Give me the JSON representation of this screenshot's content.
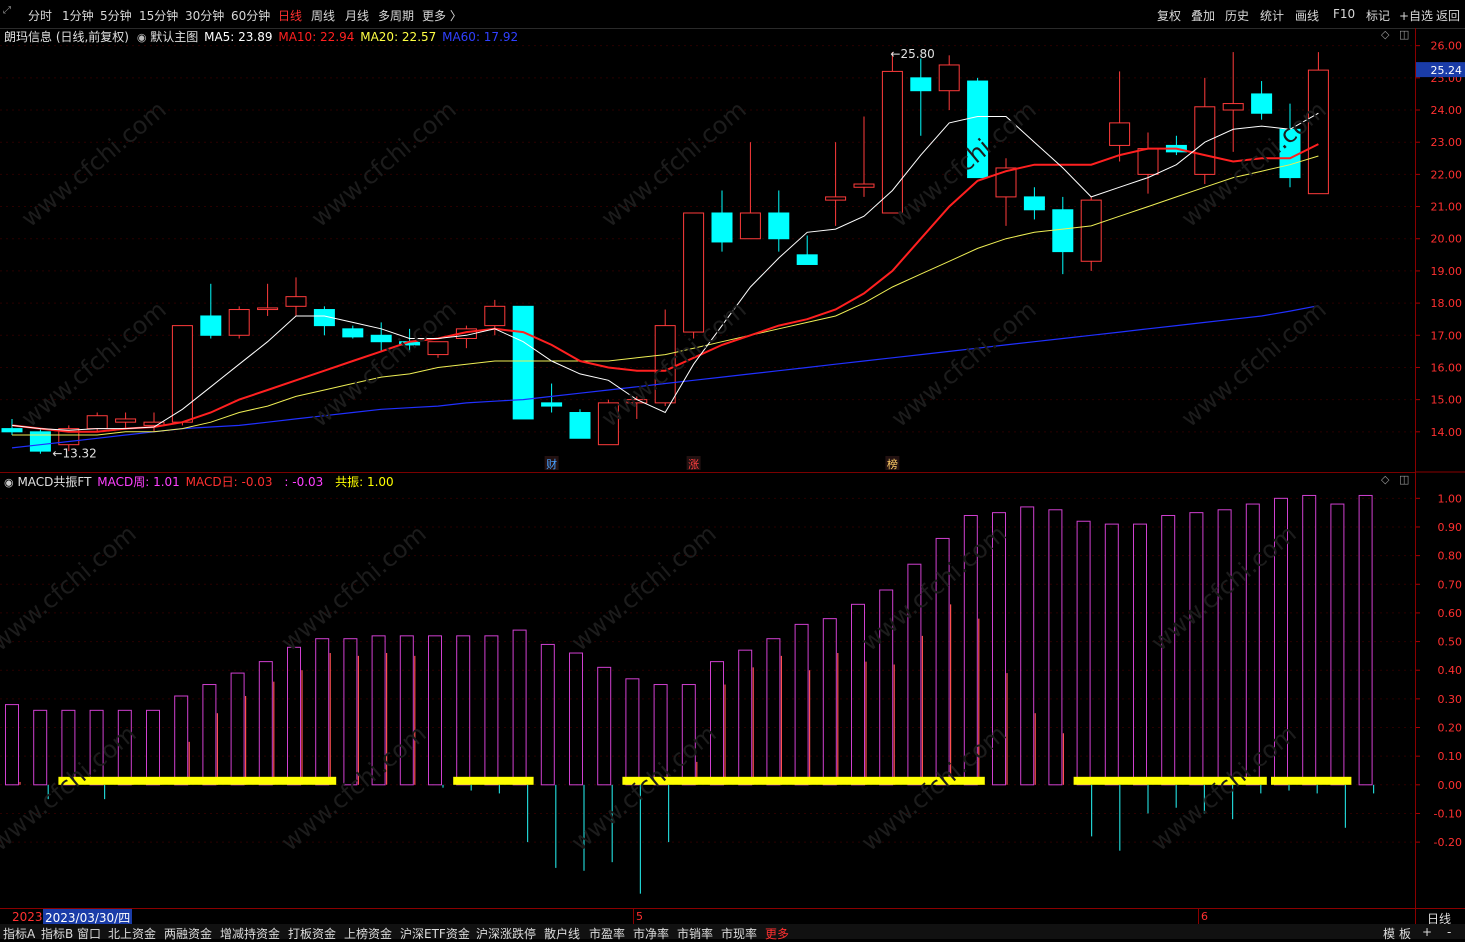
{
  "toolbar": {
    "timeframes": [
      "分时",
      "1分钟",
      "5分钟",
      "15分钟",
      "30分钟",
      "60分钟",
      "日线",
      "周线",
      "月线",
      "多周期",
      "更多 〉"
    ],
    "active_timeframe": "日线",
    "right_buttons": [
      "复权",
      "叠加",
      "历史",
      "统计",
      "画线",
      "F10",
      "标记",
      "+自选",
      "返回"
    ]
  },
  "main_chart": {
    "stock_title": "朗玛信息 (日线,前复权)",
    "template_label": "默认主图",
    "ma_legend": [
      {
        "label": "MA5: 23.89",
        "color": "#ffffff"
      },
      {
        "label": "MA10: 22.94",
        "color": "#ff2020"
      },
      {
        "label": "MA20: 22.57",
        "color": "#ffff44"
      },
      {
        "label": "MA60: 17.92",
        "color": "#3040ff"
      }
    ],
    "price_axis": [
      "26.00",
      "25.00",
      "24.00",
      "23.00",
      "22.00",
      "21.00",
      "20.00",
      "19.00",
      "18.00",
      "17.00",
      "16.00",
      "15.00",
      "14.00"
    ],
    "current_price": "25.24",
    "high_annotation": "25.80",
    "low_annotation": "13.32",
    "markers": [
      "财",
      "涨",
      "榜"
    ]
  },
  "macd_panel": {
    "title": "MACD共振FT",
    "legend": [
      {
        "label": "MACD周: 1.01",
        "color": "#ff40ff"
      },
      {
        "label": "MACD日: -0.03",
        "color": "#ff3030"
      },
      {
        "label": ": -0.03",
        "color": "#ff40ff"
      },
      {
        "label": "共振: 1.00",
        "color": "#ffff00"
      }
    ],
    "axis": [
      "1.00",
      "0.90",
      "0.80",
      "0.70",
      "0.60",
      "0.50",
      "0.40",
      "0.30",
      "0.20",
      "0.10",
      "0.00",
      "-0.10",
      "-0.20"
    ]
  },
  "date_bar": {
    "year": "2023",
    "cursor_date": "2023/03/30/四",
    "month_labels": [
      "5",
      "6"
    ],
    "period_label": "日线"
  },
  "bottom_tabs": [
    "指标A",
    "指标B",
    "窗口",
    "北上资金",
    "两融资金",
    "增减持资金",
    "打板资金",
    "上榜资金",
    "沪深ETF资金",
    "沪深涨跌停",
    "散户线",
    "市盈率",
    "市净率",
    "市销率",
    "市现率",
    "更多"
  ],
  "bottom_right": [
    "模",
    "板",
    "+",
    "-"
  ],
  "chart_data": {
    "type": "candlestick",
    "ylim": [
      13.0,
      26.3
    ],
    "candles": [
      {
        "o": 14.1,
        "h": 14.4,
        "l": 13.9,
        "c": 14.0
      },
      {
        "o": 14.0,
        "h": 14.1,
        "l": 13.32,
        "c": 13.4
      },
      {
        "o": 13.6,
        "h": 14.2,
        "l": 13.4,
        "c": 14.1
      },
      {
        "o": 14.1,
        "h": 14.6,
        "l": 14.0,
        "c": 14.5
      },
      {
        "o": 14.3,
        "h": 14.6,
        "l": 14.1,
        "c": 14.4
      },
      {
        "o": 14.2,
        "h": 14.6,
        "l": 14.0,
        "c": 14.3
      },
      {
        "o": 14.3,
        "h": 17.3,
        "l": 14.2,
        "c": 17.3
      },
      {
        "o": 17.6,
        "h": 18.6,
        "l": 16.9,
        "c": 17.0
      },
      {
        "o": 17.0,
        "h": 17.9,
        "l": 16.9,
        "c": 17.8
      },
      {
        "o": 17.8,
        "h": 18.6,
        "l": 17.6,
        "c": 17.85
      },
      {
        "o": 17.9,
        "h": 18.8,
        "l": 17.6,
        "c": 18.2
      },
      {
        "o": 17.8,
        "h": 17.9,
        "l": 17.0,
        "c": 17.3
      },
      {
        "o": 17.2,
        "h": 17.3,
        "l": 16.9,
        "c": 16.95
      },
      {
        "o": 17.0,
        "h": 17.4,
        "l": 16.5,
        "c": 16.8
      },
      {
        "o": 16.8,
        "h": 17.2,
        "l": 16.5,
        "c": 16.7
      },
      {
        "o": 16.4,
        "h": 16.8,
        "l": 16.3,
        "c": 16.8
      },
      {
        "o": 16.9,
        "h": 17.3,
        "l": 16.6,
        "c": 17.2
      },
      {
        "o": 17.3,
        "h": 18.1,
        "l": 17.0,
        "c": 17.9
      },
      {
        "o": 17.9,
        "h": 17.9,
        "l": 14.4,
        "c": 14.4
      },
      {
        "o": 14.9,
        "h": 15.5,
        "l": 14.6,
        "c": 14.8
      },
      {
        "o": 14.6,
        "h": 14.7,
        "l": 13.8,
        "c": 13.8
      },
      {
        "o": 13.6,
        "h": 15.0,
        "l": 13.6,
        "c": 14.9
      },
      {
        "o": 14.9,
        "h": 15.1,
        "l": 14.4,
        "c": 15.0
      },
      {
        "o": 14.9,
        "h": 17.8,
        "l": 14.8,
        "c": 17.3
      },
      {
        "o": 17.1,
        "h": 20.8,
        "l": 16.9,
        "c": 20.8
      },
      {
        "o": 20.8,
        "h": 21.5,
        "l": 19.6,
        "c": 19.9
      },
      {
        "o": 20.0,
        "h": 23.0,
        "l": 20.0,
        "c": 20.8
      },
      {
        "o": 20.8,
        "h": 21.5,
        "l": 19.6,
        "c": 20.0
      },
      {
        "o": 19.5,
        "h": 20.1,
        "l": 19.2,
        "c": 19.2
      },
      {
        "o": 21.2,
        "h": 23.0,
        "l": 20.4,
        "c": 21.3
      },
      {
        "o": 21.6,
        "h": 23.8,
        "l": 21.3,
        "c": 21.7
      },
      {
        "o": 20.8,
        "h": 25.8,
        "l": 20.8,
        "c": 25.2
      },
      {
        "o": 25.0,
        "h": 25.6,
        "l": 23.2,
        "c": 24.6
      },
      {
        "o": 24.6,
        "h": 25.7,
        "l": 24.0,
        "c": 25.4
      },
      {
        "o": 24.9,
        "h": 25.0,
        "l": 21.9,
        "c": 21.9
      },
      {
        "o": 21.3,
        "h": 22.5,
        "l": 20.4,
        "c": 22.2
      },
      {
        "o": 21.3,
        "h": 21.6,
        "l": 20.6,
        "c": 20.9
      },
      {
        "o": 20.9,
        "h": 21.3,
        "l": 18.9,
        "c": 19.6
      },
      {
        "o": 19.3,
        "h": 21.3,
        "l": 19.0,
        "c": 21.2
      },
      {
        "o": 22.9,
        "h": 25.2,
        "l": 22.4,
        "c": 23.6
      },
      {
        "o": 22.0,
        "h": 23.3,
        "l": 21.4,
        "c": 22.8
      },
      {
        "o": 22.9,
        "h": 23.2,
        "l": 22.6,
        "c": 22.7
      },
      {
        "o": 22.0,
        "h": 25.0,
        "l": 21.7,
        "c": 24.1
      },
      {
        "o": 24.0,
        "h": 25.8,
        "l": 22.7,
        "c": 24.2
      },
      {
        "o": 24.5,
        "h": 24.9,
        "l": 23.7,
        "c": 23.9
      },
      {
        "o": 23.4,
        "h": 24.2,
        "l": 21.6,
        "c": 21.9
      },
      {
        "o": 21.4,
        "h": 25.8,
        "l": 21.4,
        "c": 25.24
      }
    ],
    "ma5": [
      14.2,
      14.1,
      14.05,
      14.1,
      14.1,
      14.15,
      14.7,
      15.4,
      16.1,
      16.8,
      17.6,
      17.6,
      17.4,
      17.2,
      16.9,
      16.9,
      17.0,
      17.2,
      16.8,
      16.2,
      15.8,
      15.6,
      15.0,
      14.6,
      16.1,
      17.3,
      18.5,
      19.4,
      20.2,
      20.3,
      20.7,
      21.5,
      22.6,
      23.6,
      23.8,
      23.8,
      23.0,
      22.2,
      21.3,
      21.6,
      21.9,
      22.3,
      23.0,
      23.4,
      23.5,
      23.4,
      23.9
    ],
    "ma10": [
      14.2,
      14.1,
      14.0,
      14.0,
      14.1,
      14.15,
      14.3,
      14.6,
      15.0,
      15.3,
      15.6,
      15.9,
      16.2,
      16.5,
      16.8,
      16.9,
      17.1,
      17.2,
      17.1,
      16.7,
      16.2,
      16.0,
      15.9,
      15.9,
      16.3,
      16.7,
      17.0,
      17.3,
      17.5,
      17.8,
      18.3,
      19.0,
      20.0,
      21.0,
      21.8,
      22.1,
      22.3,
      22.3,
      22.3,
      22.6,
      22.8,
      22.8,
      22.6,
      22.4,
      22.5,
      22.5,
      22.94
    ],
    "ma20": [
      13.9,
      13.9,
      13.9,
      13.9,
      14.0,
      14.0,
      14.1,
      14.3,
      14.6,
      14.8,
      15.1,
      15.3,
      15.5,
      15.7,
      15.8,
      16.0,
      16.1,
      16.2,
      16.2,
      16.2,
      16.2,
      16.2,
      16.3,
      16.4,
      16.6,
      16.8,
      17.0,
      17.2,
      17.4,
      17.6,
      18.0,
      18.5,
      18.9,
      19.3,
      19.7,
      20.0,
      20.2,
      20.3,
      20.4,
      20.7,
      21.0,
      21.3,
      21.6,
      21.9,
      22.1,
      22.3,
      22.57
    ],
    "ma60": [
      13.5,
      13.6,
      13.7,
      13.8,
      13.9,
      14.0,
      14.1,
      14.15,
      14.2,
      14.3,
      14.4,
      14.5,
      14.6,
      14.7,
      14.75,
      14.8,
      14.9,
      14.95,
      15.0,
      15.1,
      15.2,
      15.3,
      15.4,
      15.5,
      15.6,
      15.7,
      15.8,
      15.9,
      16.0,
      16.1,
      16.2,
      16.3,
      16.4,
      16.5,
      16.6,
      16.7,
      16.8,
      16.9,
      17.0,
      17.1,
      17.2,
      17.3,
      17.4,
      17.5,
      17.6,
      17.75,
      17.92
    ],
    "macd_week": [
      0.28,
      0.26,
      0.26,
      0.26,
      0.26,
      0.26,
      0.31,
      0.35,
      0.39,
      0.43,
      0.48,
      0.51,
      0.51,
      0.52,
      0.52,
      0.52,
      0.52,
      0.52,
      0.54,
      0.49,
      0.46,
      0.41,
      0.37,
      0.35,
      0.35,
      0.43,
      0.47,
      0.51,
      0.56,
      0.58,
      0.63,
      0.68,
      0.77,
      0.86,
      0.94,
      0.95,
      0.97,
      0.96,
      0.92,
      0.91,
      0.91,
      0.94,
      0.95,
      0.96,
      0.98,
      1.0,
      1.01,
      0.98,
      1.01
    ],
    "macd_day": [
      0.01,
      -0.05,
      0.01,
      -0.05,
      0.01,
      0.01,
      0.15,
      0.25,
      0.31,
      0.36,
      0.4,
      0.46,
      0.45,
      0.46,
      0.45,
      -0.01,
      -0.02,
      -0.03,
      -0.2,
      -0.29,
      -0.3,
      -0.27,
      -0.38,
      -0.2,
      0.08,
      0.35,
      0.41,
      0.45,
      0.4,
      0.46,
      0.43,
      0.42,
      0.52,
      0.63,
      0.58,
      0.39,
      0.25,
      0.18,
      -0.18,
      -0.23,
      -0.1,
      -0.08,
      -0.1,
      -0.12,
      -0.03,
      -0.02,
      -0.03,
      -0.15,
      -0.03
    ],
    "resonance_segments": [
      [
        2,
        11
      ],
      [
        16,
        18
      ],
      [
        22,
        34
      ],
      [
        38,
        44
      ],
      [
        45,
        47
      ]
    ],
    "resonance_value": 1.0,
    "macd_ylim": [
      -0.43,
      1.05
    ]
  }
}
